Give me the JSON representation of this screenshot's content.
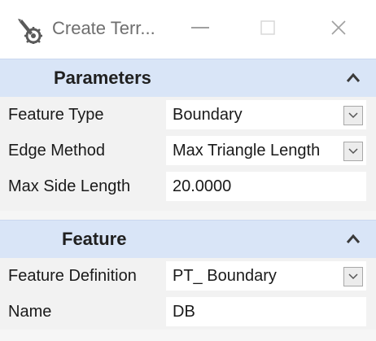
{
  "window": {
    "title": "Create Terr...",
    "icons": {
      "app": "gear-pen-icon",
      "minimize": "minimize-icon",
      "maximize": "maximize-icon",
      "close": "close-icon"
    }
  },
  "panels": {
    "parameters": {
      "title": "Parameters",
      "collapse_icon": "chevron-up-icon",
      "rows": [
        {
          "label": "Feature Type",
          "value": "Boundary",
          "type": "dropdown"
        },
        {
          "label": "Edge Method",
          "value": "Max Triangle Length",
          "type": "dropdown"
        },
        {
          "label": "Max Side Length",
          "value": "20.0000",
          "type": "input"
        }
      ]
    },
    "feature": {
      "title": "Feature",
      "collapse_icon": "chevron-up-icon",
      "rows": [
        {
          "label": "Feature Definition",
          "value": "PT_ Boundary",
          "type": "dropdown"
        },
        {
          "label": "Name",
          "value": "DB",
          "type": "input"
        }
      ]
    }
  },
  "colors": {
    "panel_header": "#d9e5f7",
    "body": "#f2f2f2",
    "field": "#ffffff"
  }
}
